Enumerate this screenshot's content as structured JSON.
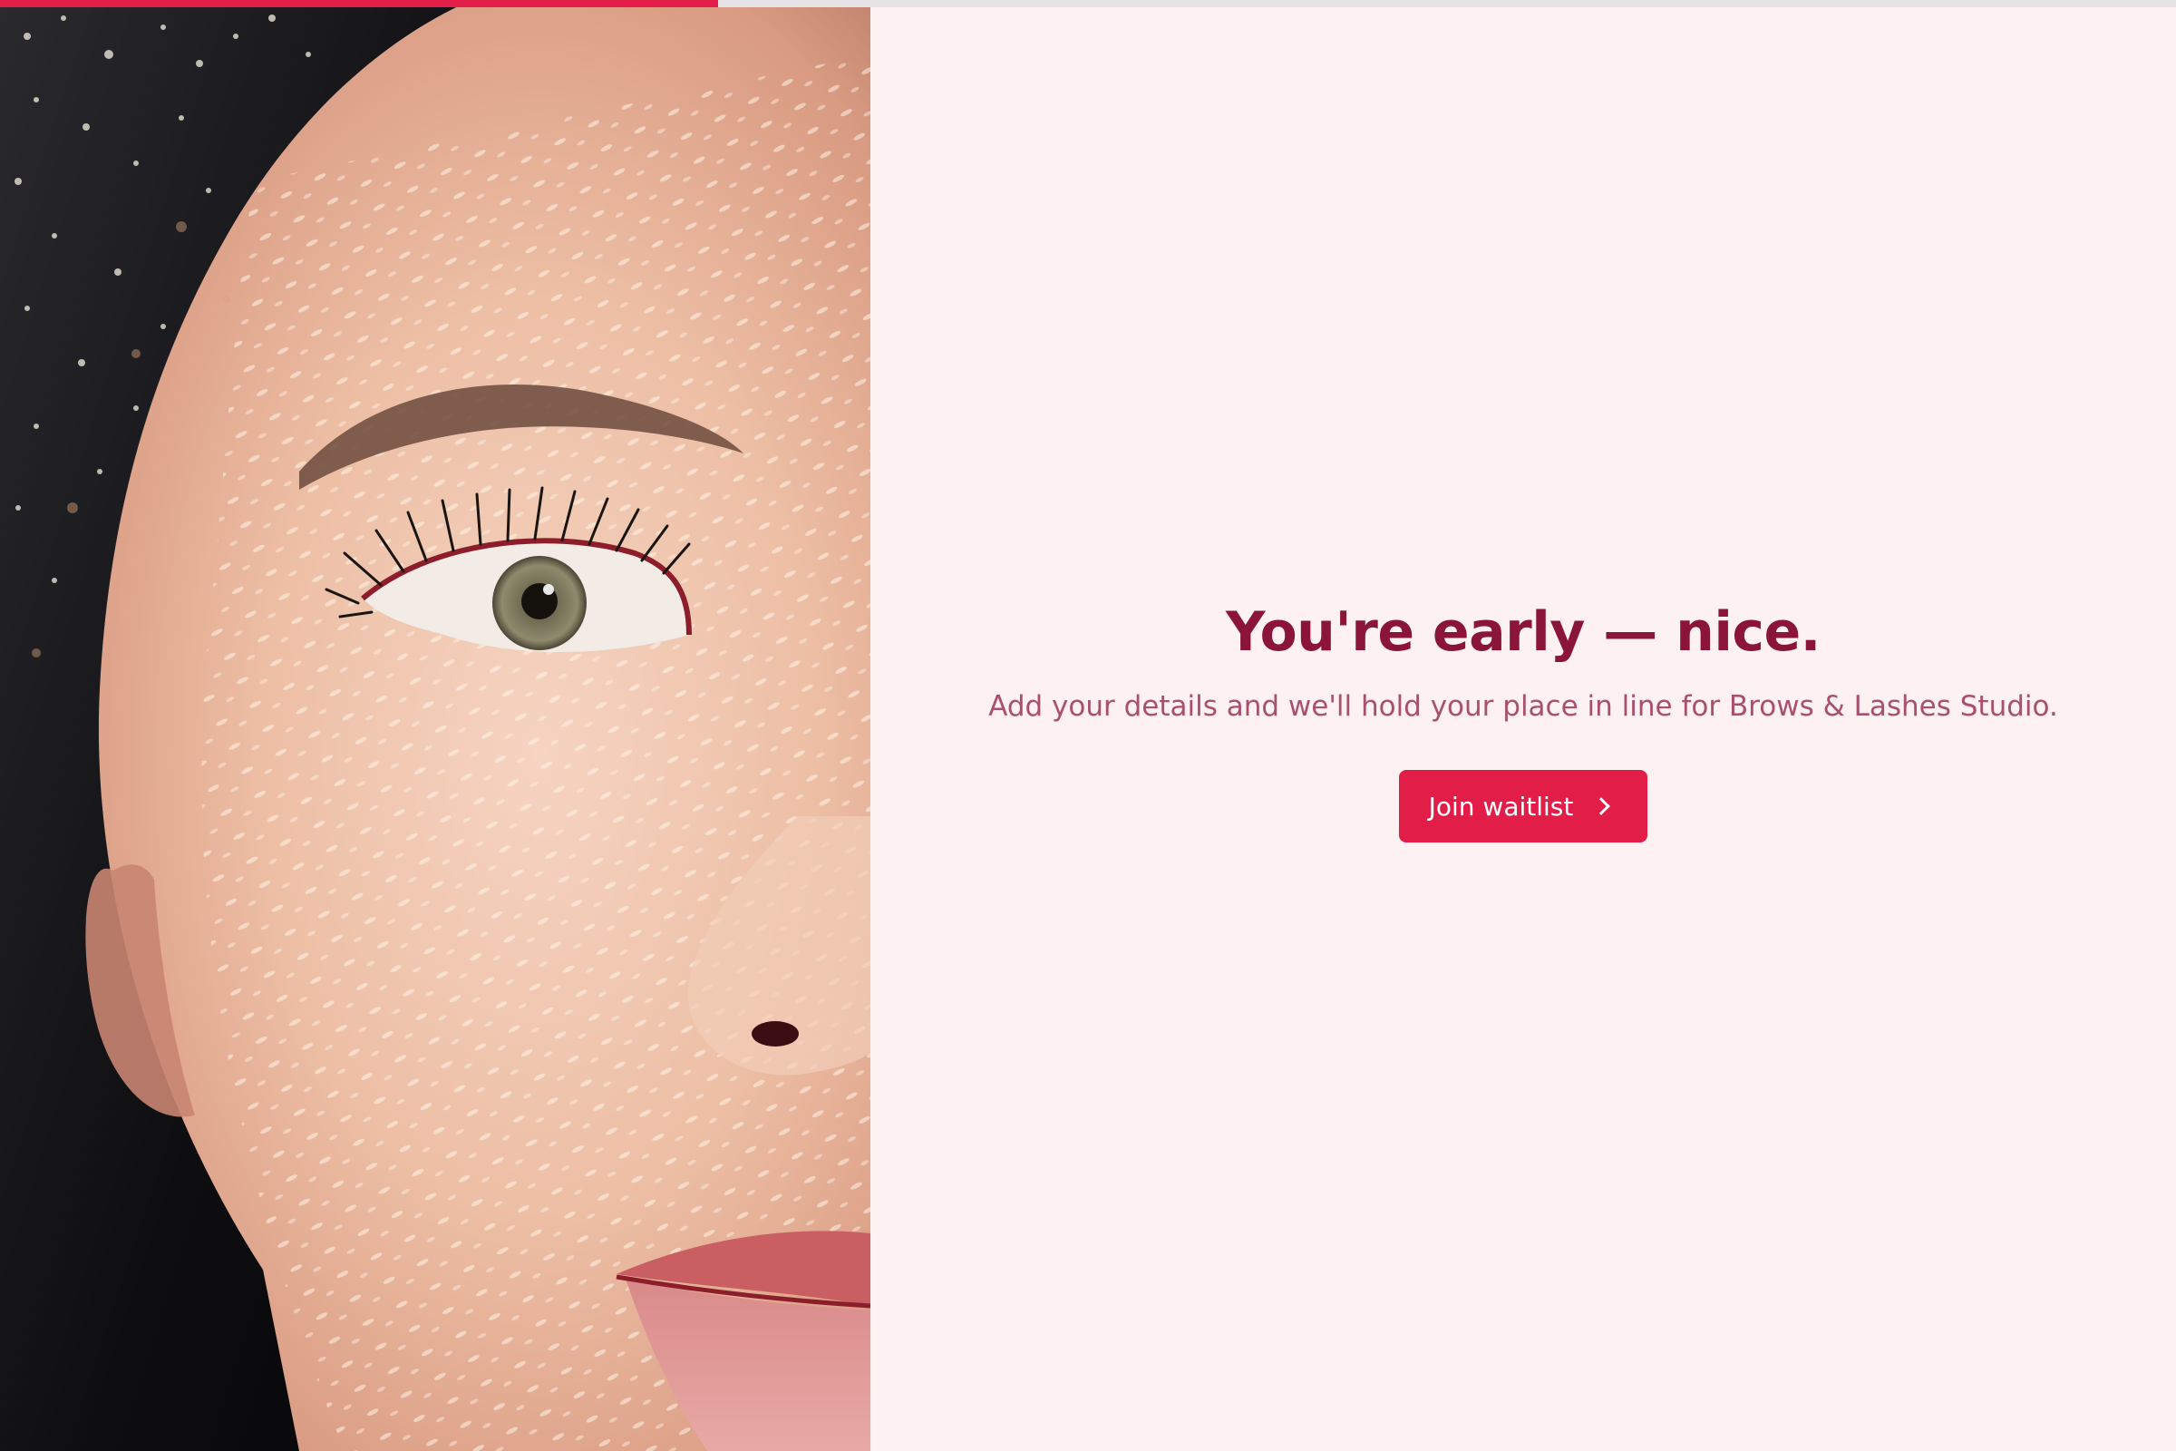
{
  "progress": {
    "fraction": 0.33,
    "fill_color": "#e11d48",
    "track_color": "#e6e3e6"
  },
  "hero_image": {
    "icon": "portrait-photo"
  },
  "main": {
    "headline": "You're early — nice.",
    "subtext": "Add your details and we'll hold your place in line for Brows & Lashes Studio.",
    "cta_label": "Join waitlist",
    "cta_icon": "chevron-right-icon"
  },
  "colors": {
    "accent": "#e11d48",
    "headline": "#8a1538",
    "subtext": "#a8506e",
    "background": "#fdf1f1"
  }
}
